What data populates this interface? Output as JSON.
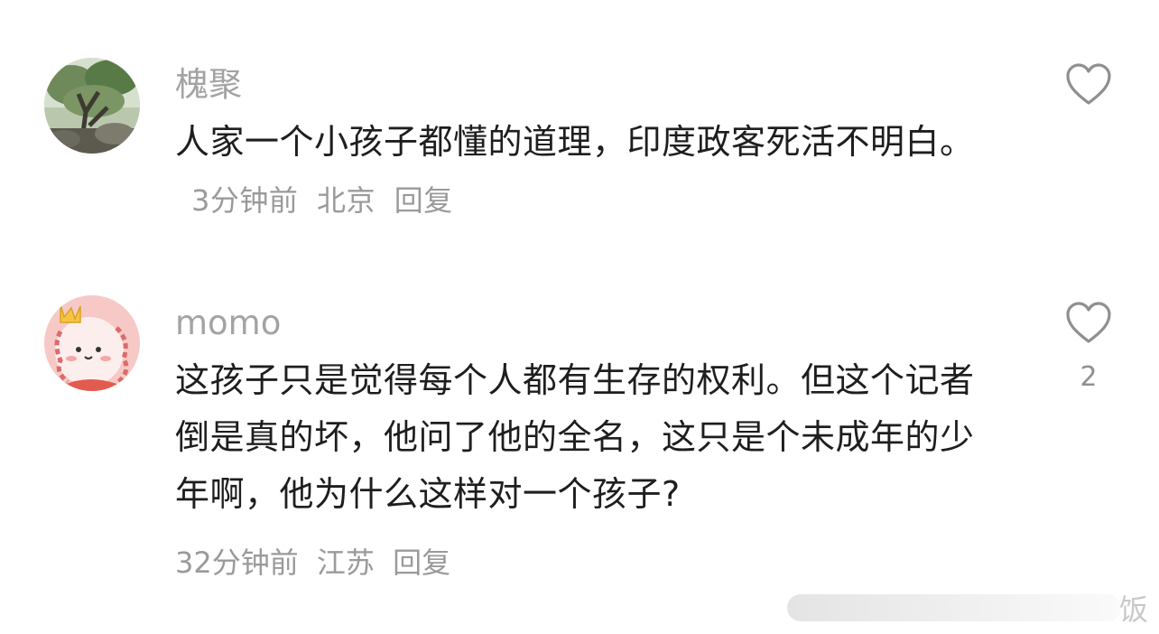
{
  "comments": [
    {
      "username": "槐聚",
      "text": "人家一个小孩子都懂的道理，印度政客死活不明白。",
      "time": "3分钟前",
      "location": "北京",
      "reply_label": "回复",
      "likes": ""
    },
    {
      "username": "momo",
      "text": "这孩子只是觉得每个人都有生存的权利。但这个记者倒是真的坏，他问了他的全名，这只是个未成年的少年啊，他为什么这样对一个孩子?",
      "time": "32分钟前",
      "location": "江苏",
      "reply_label": "回复",
      "likes": "2"
    }
  ],
  "watermark": {
    "text": "饭"
  },
  "icons": {
    "like": "heart-outline-icon"
  },
  "colors": {
    "username": "#a3a3a3",
    "text": "#1e1e1e",
    "meta": "#9a9a9a",
    "icon": "#8f8f8f"
  }
}
